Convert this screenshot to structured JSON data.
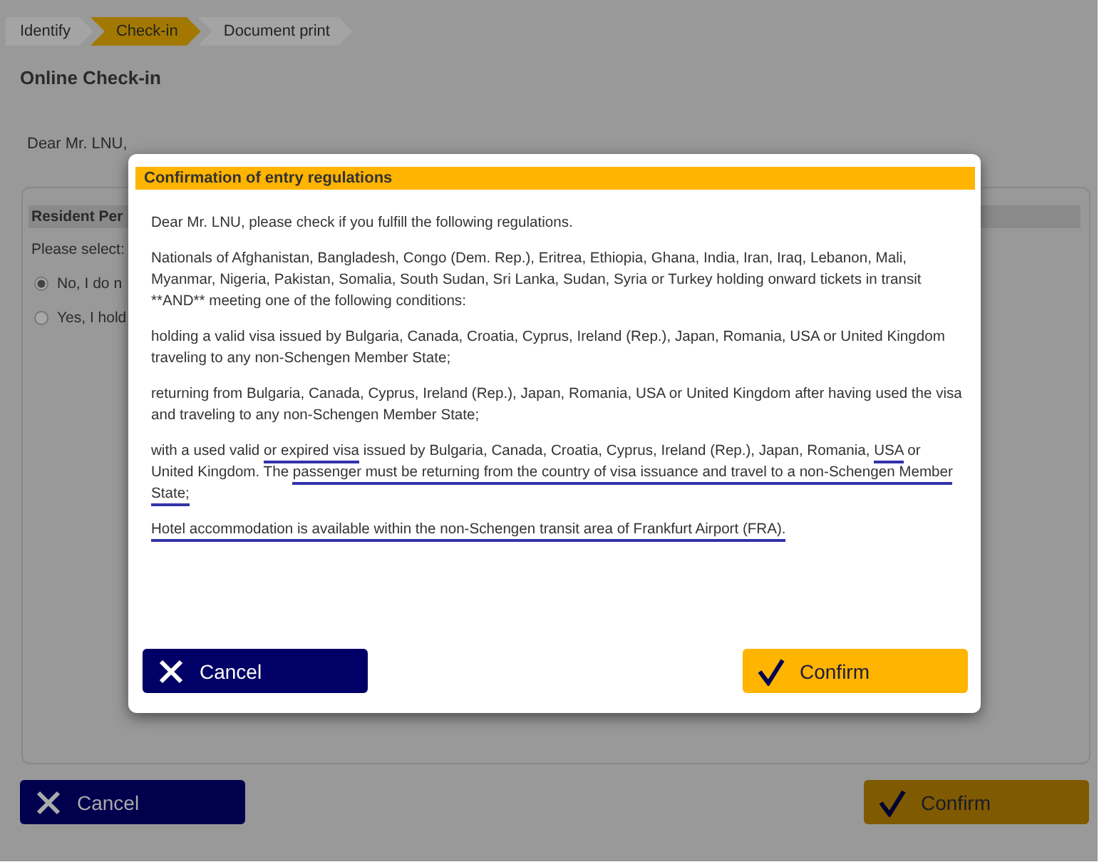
{
  "steps": [
    {
      "label": "Identify",
      "selected": false
    },
    {
      "label": "Check-in",
      "selected": true
    },
    {
      "label": "Document print",
      "selected": false
    }
  ],
  "page_title": "Online Check-in",
  "intro": "Dear Mr. LNU,",
  "panel": {
    "header": "Resident Per",
    "prompt": "Please select:",
    "options": [
      {
        "label": "No, I do n",
        "selected": true
      },
      {
        "label": "Yes, I hold",
        "selected": false
      }
    ]
  },
  "page_buttons": [
    {
      "kind": "cancel",
      "label": "Cancel"
    },
    {
      "kind": "confirm",
      "label": "Confirm"
    }
  ],
  "dialog": {
    "title": "Confirmation of entry regulations",
    "paragraphs": [
      [
        {
          "text": "Dear Mr. LNU, please check if you fulfill the following regulations.",
          "underlined": false
        }
      ],
      [
        {
          "text": "Nationals of Afghanistan, Bangladesh, Congo (Dem. Rep.), Eritrea, Ethiopia, Ghana, India, Iran, Iraq, Lebanon, Mali, Myanmar, Nigeria, Pakistan, Somalia, South Sudan, Sri Lanka, Sudan, Syria or Turkey holding onward tickets in transit **AND** meeting one of the following conditions:",
          "underlined": false
        }
      ],
      [
        {
          "text": "holding a valid visa issued by Bulgaria, Canada, Croatia, Cyprus, Ireland (Rep.), Japan, Romania, USA or United Kingdom traveling to any non-Schengen Member State;",
          "underlined": false
        }
      ],
      [
        {
          "text": "returning from Bulgaria, Canada, Cyprus, Ireland (Rep.), Japan, Romania, USA or United Kingdom after having used the visa and traveling to any non-Schengen Member State;",
          "underlined": false
        }
      ],
      [
        {
          "text": "with a used valid ",
          "underlined": false
        },
        {
          "text": "or expired visa",
          "underlined": true
        },
        {
          "text": " issued by Bulgaria, Canada, Croatia, Cyprus, Ireland (Rep.), Japan, Romania, ",
          "underlined": false
        },
        {
          "text": "USA",
          "underlined": true
        },
        {
          "text": " or United Kingdom. The ",
          "underlined": false
        },
        {
          "text": "passenger must be returning from the country of visa issuance and travel to a non-Schengen Member State;",
          "underlined": true
        }
      ],
      [
        {
          "text": "Hotel accommodation is available within the non-Schengen transit area of Frankfurt Airport (FRA).",
          "underlined": true
        }
      ]
    ],
    "buttons": [
      {
        "kind": "cancel",
        "label": "Cancel"
      },
      {
        "kind": "confirm",
        "label": "Confirm"
      }
    ]
  }
}
